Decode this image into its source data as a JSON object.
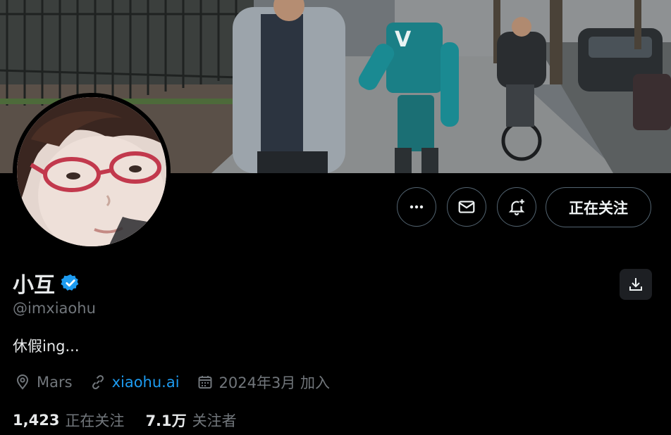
{
  "profile": {
    "display_name": "小互",
    "verified": true,
    "handle": "@imxiaohu",
    "bio": "休假ing...",
    "location": "Mars",
    "website": "xiaohu.ai",
    "joined": "2024年3月 加入"
  },
  "stats": {
    "following_count": "1,423",
    "following_label": "正在关注",
    "followers_count": "7.1万",
    "followers_label": "关注者"
  },
  "actions": {
    "follow_label": "正在关注"
  },
  "icons": {
    "more": "more-horizontal-icon",
    "message": "envelope-icon",
    "subscribe": "bell-plus-icon",
    "verified": "verified-badge-icon",
    "location": "location-pin-icon",
    "link": "link-icon",
    "calendar": "calendar-icon",
    "download": "download-icon"
  },
  "colors": {
    "background": "#000000",
    "text_primary": "#e7e9ea",
    "text_secondary": "#71767b",
    "link": "#1d9bf0",
    "verified_badge": "#1d9bf0",
    "button_border": "#536471"
  }
}
